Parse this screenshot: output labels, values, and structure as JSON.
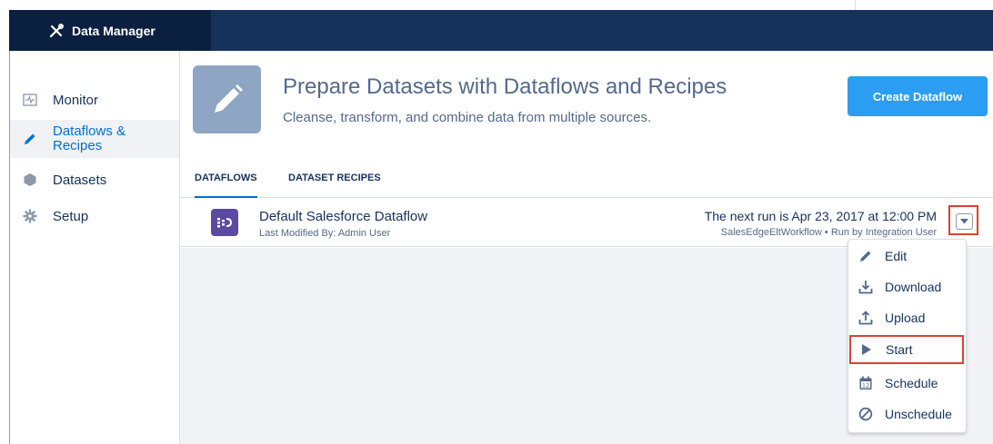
{
  "app": {
    "title": "Data Manager"
  },
  "sidebar": {
    "items": [
      {
        "label": "Monitor",
        "icon": "monitor-icon"
      },
      {
        "label": "Dataflows &",
        "label2": "Recipes",
        "icon": "pencil-icon",
        "active": true
      },
      {
        "label": "Datasets",
        "icon": "hexagon-icon"
      },
      {
        "label": "Setup",
        "icon": "gear-icon"
      }
    ]
  },
  "header": {
    "title": "Prepare Datasets with Dataflows and Recipes",
    "subtitle": "Cleanse, transform, and combine data from multiple sources.",
    "create_button": "Create Dataflow"
  },
  "tabs": [
    {
      "label": "DATAFLOWS",
      "active": true
    },
    {
      "label": "DATASET RECIPES",
      "active": false
    }
  ],
  "dataflow": {
    "name": "Default Salesforce Dataflow",
    "modified": "Last Modified By: Admin User",
    "next_run": "The next run is Apr 23, 2017 at 12:00 PM",
    "run_info": "SalesEdgeEltWorkflow • Run by Integration User"
  },
  "menu": {
    "items": [
      {
        "label": "Edit",
        "icon": "pencil-icon"
      },
      {
        "label": "Download",
        "icon": "download-icon"
      },
      {
        "label": "Upload",
        "icon": "upload-icon"
      },
      {
        "label": "Start",
        "icon": "play-icon",
        "highlighted": true
      },
      {
        "label": "Schedule",
        "icon": "calendar-icon"
      },
      {
        "label": "Unschedule",
        "icon": "ban-icon"
      }
    ]
  },
  "colors": {
    "app_bar": "#16325c",
    "brand_blue": "#0070d2",
    "button_blue": "#2b9df2",
    "highlight_red": "#d94236",
    "dataflow_icon": "#5a4aa2",
    "header_icon": "#8ea5c3"
  }
}
